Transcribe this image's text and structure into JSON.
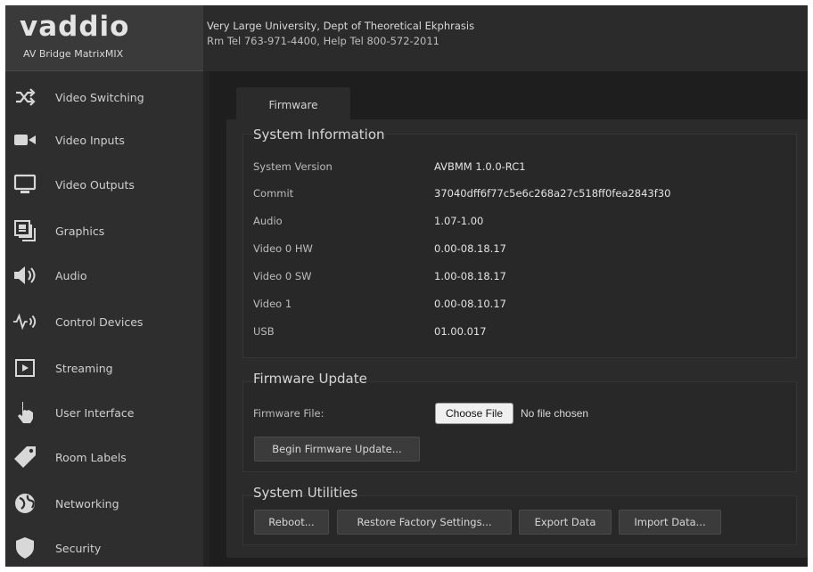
{
  "header": {
    "logo_text": "vaddio",
    "product_name": "AV Bridge MatrixMIX",
    "org_name": "Very Large University, Dept of Theoretical Ekphrasis",
    "org_phone": "Rm Tel 763-971-4400, Help Tel 800-572-2011"
  },
  "sidebar": {
    "items": [
      {
        "label": "Video Switching",
        "icon": "shuffle-icon"
      },
      {
        "label": "Video Inputs",
        "icon": "video-camera-icon"
      },
      {
        "label": "Video Outputs",
        "icon": "monitor-icon"
      },
      {
        "label": "Graphics",
        "icon": "graphics-icon"
      },
      {
        "label": "Audio",
        "icon": "speaker-icon"
      },
      {
        "label": "Control Devices",
        "icon": "control-wave-icon"
      },
      {
        "label": "Streaming",
        "icon": "play-box-icon"
      },
      {
        "label": "User Interface",
        "icon": "pointer-hand-icon"
      },
      {
        "label": "Room Labels",
        "icon": "tag-icon"
      },
      {
        "label": "Networking",
        "icon": "globe-icon"
      },
      {
        "label": "Security",
        "icon": "shield-icon"
      }
    ]
  },
  "main": {
    "tab_label": "Firmware",
    "system_info": {
      "title": "System Information",
      "rows": [
        {
          "label": "System Version",
          "value": "AVBMM 1.0.0-RC1"
        },
        {
          "label": "Commit",
          "value": "37040dff6f77c5e6c268a27c518ff0fea2843f30"
        },
        {
          "label": "Audio",
          "value": "1.07-1.00"
        },
        {
          "label": "Video 0 HW",
          "value": "0.00-08.18.17"
        },
        {
          "label": "Video 0 SW",
          "value": "1.00-08.18.17"
        },
        {
          "label": "Video 1",
          "value": "0.00-08.10.17"
        },
        {
          "label": "USB",
          "value": "01.00.017"
        }
      ]
    },
    "firmware_update": {
      "title": "Firmware Update",
      "file_label": "Firmware File:",
      "choose_file_label": "Choose File",
      "no_file_text": "No file chosen",
      "begin_button": "Begin Firmware Update..."
    },
    "system_utilities": {
      "title": "System Utilities",
      "buttons": [
        "Reboot...",
        "Restore Factory Settings...",
        "Export Data",
        "Import Data..."
      ]
    }
  },
  "colors": {
    "background": "#232323",
    "sidebar": "#2e2e2e",
    "panel": "#2b2b2b",
    "text": "#d6d6d6"
  }
}
